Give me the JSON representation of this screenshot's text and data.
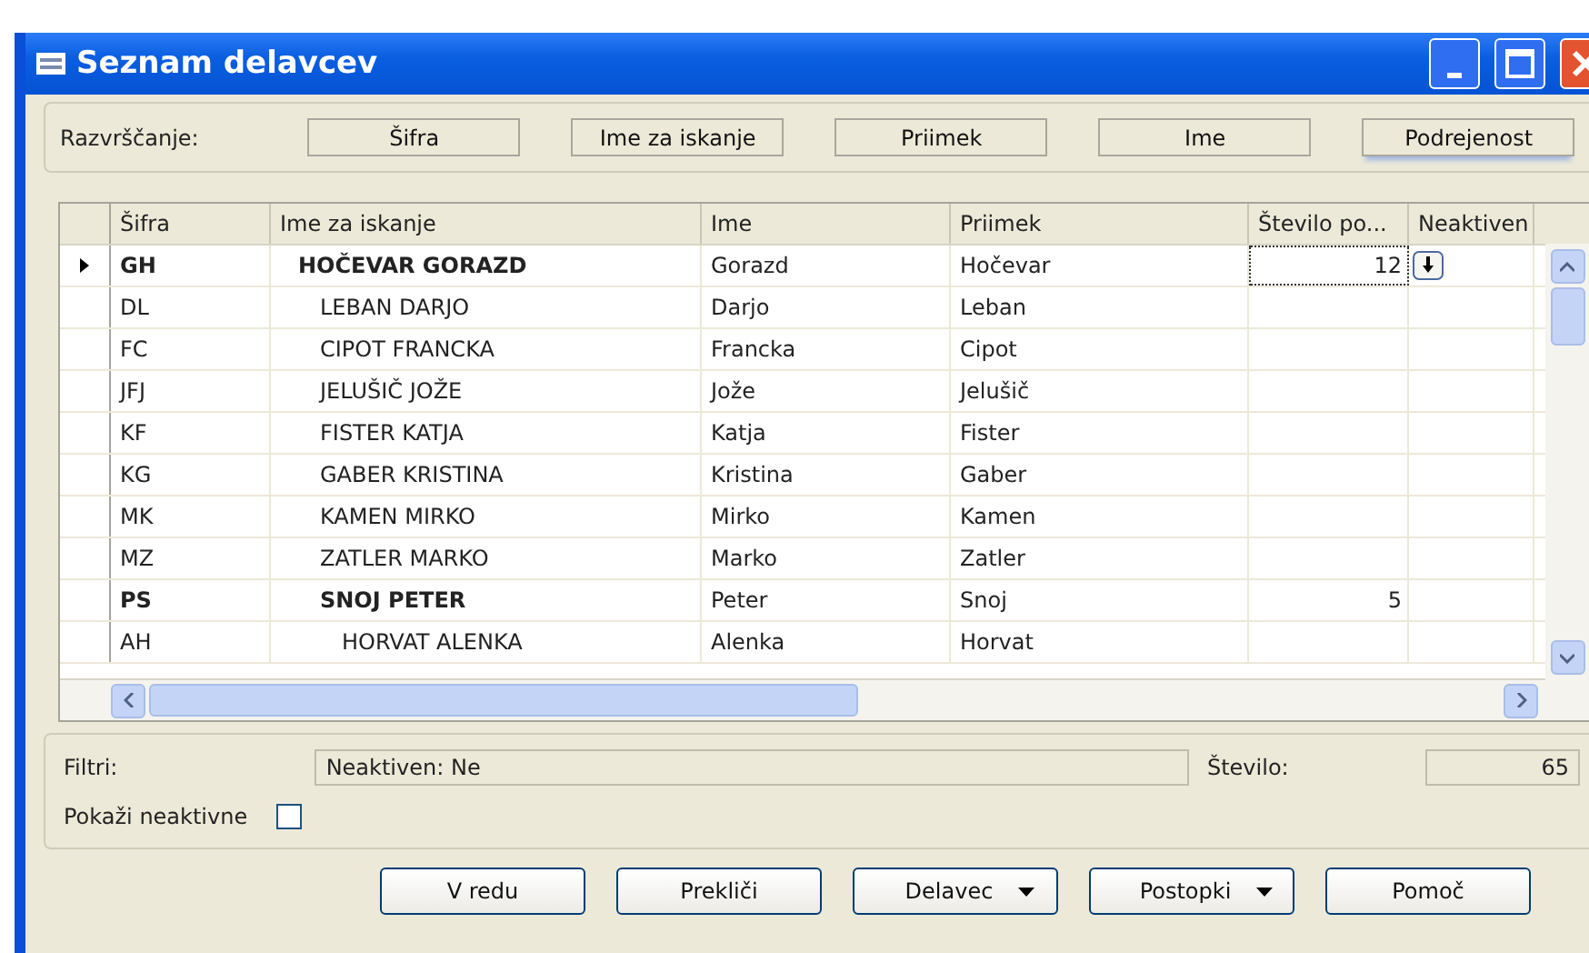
{
  "window": {
    "title": "Seznam delavcev"
  },
  "sorting": {
    "label": "Razvrščanje:",
    "buttons": [
      {
        "label": "Šifra",
        "selected": false
      },
      {
        "label": "Ime za iskanje",
        "selected": false
      },
      {
        "label": "Priimek",
        "selected": false
      },
      {
        "label": "Ime",
        "selected": false
      },
      {
        "label": "Podrejenost",
        "selected": true
      }
    ]
  },
  "table": {
    "columns": [
      "Šifra",
      "Ime za iskanje",
      "Ime",
      "Priimek",
      "Število po...",
      "Neaktiven"
    ],
    "rows": [
      {
        "code": "GH",
        "search_name": "HOČEVAR GORAZD",
        "first_name": "Gorazd",
        "last_name": "Hočevar",
        "count": "12",
        "selected": true,
        "children": [
          {
            "code": "DL",
            "search_name": "LEBAN DARJO",
            "first_name": "Darjo",
            "last_name": "Leban",
            "selected": false
          },
          {
            "code": "FC",
            "search_name": "CIPOT FRANCKA",
            "first_name": "Francka",
            "last_name": "Cipot",
            "selected": false
          },
          {
            "code": "JFJ",
            "search_name": "JELUŠIČ JOŽE",
            "first_name": "Jože",
            "last_name": "Jelušič",
            "selected": false
          },
          {
            "code": "KF",
            "search_name": "FISTER KATJA",
            "first_name": "Katja",
            "last_name": "Fister",
            "selected": false
          },
          {
            "code": "KG",
            "search_name": "GABER KRISTINA",
            "first_name": "Kristina",
            "last_name": "Gaber",
            "selected": false
          },
          {
            "code": "MK",
            "search_name": "KAMEN MIRKO",
            "first_name": "Mirko",
            "last_name": "Kamen",
            "selected": false
          },
          {
            "code": "MZ",
            "search_name": "ZATLER MARKO",
            "first_name": "Marko",
            "last_name": "Zatler",
            "selected": false
          },
          {
            "code": "PS",
            "search_name": "SNOJ PETER",
            "first_name": "Peter",
            "last_name": "Snoj",
            "count": "5",
            "selected": false,
            "children": [
              {
                "code": "AH",
                "search_name": "HORVAT ALENKA",
                "first_name": "Alenka",
                "last_name": "Horvat",
                "selected": false
              }
            ]
          }
        ]
      }
    ]
  },
  "filters": {
    "label": "Filtri:",
    "value": "Neaktiven: Ne",
    "count_label": "Število:",
    "count": "65"
  },
  "show_inactive": {
    "label": "Pokaži neaktivne",
    "checked": false
  },
  "buttons": [
    {
      "label": "V redu",
      "kind": "plain"
    },
    {
      "label": "Prekliči",
      "kind": "plain"
    },
    {
      "label": "Delavec",
      "kind": "menu"
    },
    {
      "label": "Postopki",
      "kind": "menu"
    },
    {
      "label": "Pomoč",
      "kind": "plain"
    }
  ]
}
